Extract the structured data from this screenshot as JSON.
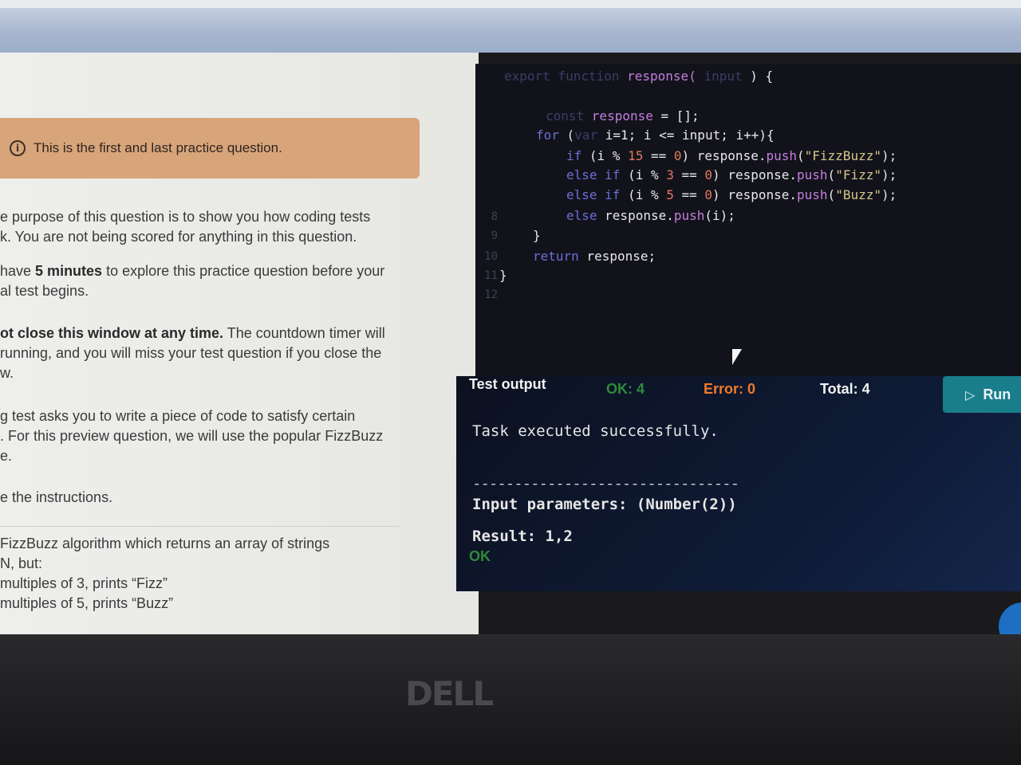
{
  "notice": {
    "text": "This is the first and last practice question."
  },
  "instructions": {
    "p1_line1": "e purpose of this question is to show you how coding tests",
    "p1_line2": "k. You are not being scored for anything in this question.",
    "p2_pre": "have ",
    "p2_bold": "5 minutes",
    "p2_post": " to explore this practice question before your",
    "p2_line2": "al test begins.",
    "p3_bold": "ot close this window at any time.",
    "p3_post": " The countdown timer will",
    "p3_line2": "running, and you will miss your test question if you close the",
    "p3_line3": "w.",
    "p4_line1": "g test asks you to write a piece of code to satisfy certain",
    "p4_line2": ". For this preview question, we will use the popular FizzBuzz",
    "p4_line3": "e.",
    "p5_line1": "e the instructions.",
    "p6_line1": "FizzBuzz algorithm which returns an array of strings",
    "p6_line2": "N, but:",
    "p6_line3": "multiples of 3, prints “Fizz”",
    "p6_line4": "multiples of 5, prints “Buzz”"
  },
  "code": {
    "line_numbers": [
      "",
      "",
      "",
      "",
      "",
      "",
      "",
      "8",
      "9",
      "10",
      "11",
      "12"
    ],
    "l1_dim": "export function ",
    "l1_fn": "response",
    "l1_paren": "( ",
    "l1_arg": "input",
    "l1_end": " ) {",
    "l2_kw": "const ",
    "l2_var": "response",
    "l2_end": " = [];",
    "l3_kw": "for",
    "l3_a": " (",
    "l3_var": "var",
    "l3_b": " i=1; i <= input; i++){",
    "l4_kw": "if",
    "l4_a": " (i % ",
    "l4_num": "15",
    "l4_b": " == ",
    "l4_zero": "0",
    "l4_c": ") response.",
    "l4_push": "push",
    "l4_d": "(",
    "l4_str": "\"FizzBuzz\"",
    "l4_e": ");",
    "l5_kw": "else if",
    "l5_a": " (i % ",
    "l5_num": "3",
    "l5_b": " == ",
    "l5_zero": "0",
    "l5_c": ") response.",
    "l5_push": "push",
    "l5_d": "(",
    "l5_str": "\"Fizz\"",
    "l5_e": ");",
    "l6_kw": "else if",
    "l6_a": " (i % ",
    "l6_num": "5",
    "l6_b": " == ",
    "l6_zero": "0",
    "l6_c": ") response.",
    "l6_push": "push",
    "l6_d": "(",
    "l6_str": "\"Buzz\"",
    "l6_e": ");",
    "l7_kw": "else",
    "l7_a": " response.",
    "l7_push": "push",
    "l7_b": "(i);",
    "l8": "}",
    "l9_kw": "return",
    "l9_a": " response;",
    "l10": "}"
  },
  "output": {
    "title": "Test output",
    "ok": "OK: 4",
    "error": "Error: 0",
    "total": "Total: 4",
    "run_label": "Run",
    "message": "Task executed successfully.",
    "separator": "--------------------------------",
    "input_params": "Input parameters: (Number(2))",
    "result": "Result: 1,2",
    "status": "OK"
  },
  "colors": {
    "notice_bg": "#d8a47a",
    "ok": "#2f8a3a",
    "error": "#f07a2a",
    "run_button": "#1a7d8a"
  },
  "brand": {
    "logo_text": "DELL"
  }
}
